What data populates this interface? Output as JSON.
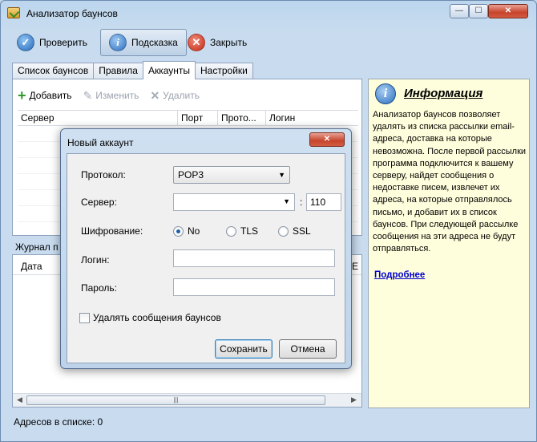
{
  "window": {
    "title": "Анализатор баунсов",
    "min": "—",
    "max": "☐",
    "close": "✕"
  },
  "toolbar": {
    "check_label": "Проверить",
    "hint_label": "Подсказка",
    "close_label": "Закрыть"
  },
  "tabs": [
    {
      "label": "Список баунсов"
    },
    {
      "label": "Правила"
    },
    {
      "label": "Аккаунты",
      "active": true
    },
    {
      "label": "Настройки"
    }
  ],
  "accounts": {
    "add_label": "Добавить",
    "edit_label": "Изменить",
    "delete_label": "Удалить",
    "columns": [
      "Сервер",
      "Порт",
      "Прото...",
      "Логин"
    ]
  },
  "journal": {
    "label": "Журнал п",
    "columns": [
      "Дата",
      "E"
    ],
    "scroll_grip": "|||"
  },
  "info": {
    "title": "Информация",
    "text": "Анализатор баунсов позволяет удалять из списка рассылки email-адреса, доставка на которые невозможна. После первой рассылки программа подключится к вашему серверу, найдет сообщения о недоставке писем, извлечет их адреса, на которые отправлялось письмо, и добавит их в список баунсов. При следующей рассылке сообщения на эти адреса не будут отправляться.",
    "link": "Подробнее"
  },
  "status": {
    "label": "Адресов в списке:",
    "count": "0"
  },
  "dialog": {
    "title": "Новый аккаунт",
    "close": "✕",
    "protocol_label": "Протокол:",
    "protocol_value": "POP3",
    "server_label": "Сервер:",
    "server_value": "",
    "port_value": "110",
    "encryption_label": "Шифрование:",
    "encryption_options": [
      "No",
      "TLS",
      "SSL"
    ],
    "encryption_selected": "No",
    "login_label": "Логин:",
    "login_value": "",
    "password_label": "Пароль:",
    "password_value": "",
    "delete_bounces_label": "Удалять сообщения баунсов",
    "delete_bounces_checked": false,
    "save_label": "Сохранить",
    "cancel_label": "Отмена"
  },
  "colors": {
    "info_bg": "#fffedc",
    "link": "#0000cc",
    "accent": "#2b6fbf"
  }
}
